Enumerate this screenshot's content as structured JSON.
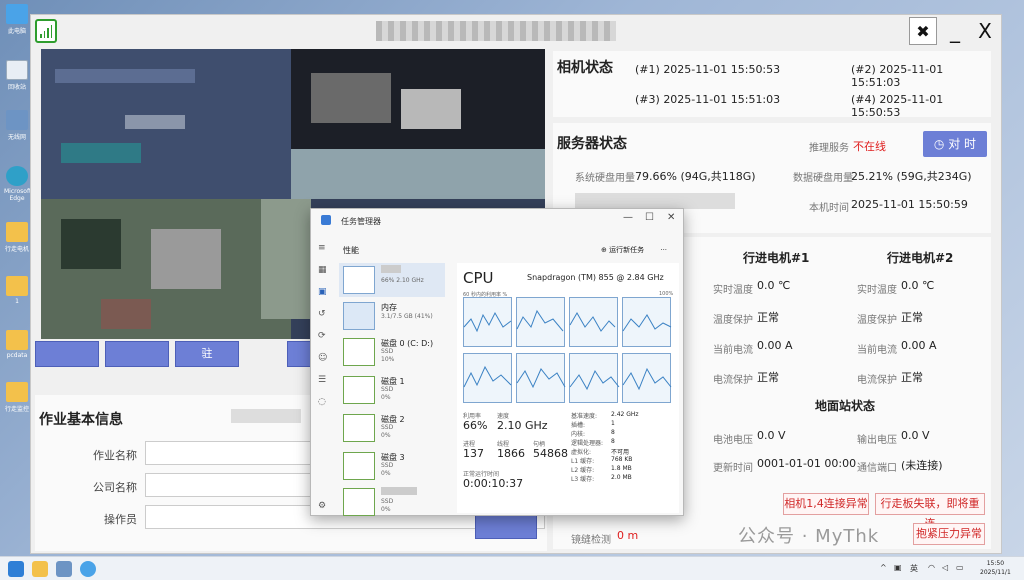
{
  "desktop": {
    "icons": [
      {
        "label": "此电脑"
      },
      {
        "label": "回收站"
      },
      {
        "label": "无线网"
      },
      {
        "label": "Microsoft Edge"
      },
      {
        "label": "行走电机"
      },
      {
        "label": "1"
      },
      {
        "label": "pcdata"
      },
      {
        "label": "行走监控"
      }
    ]
  },
  "app": {
    "title": "■■■■■■■■■■■■■■",
    "tools_icon": "wrench-screwdriver-icon",
    "minimize_label": "_",
    "close_label": "X"
  },
  "camera_buttons": [
    {
      "label": ""
    },
    {
      "label": ""
    },
    {
      "label": "驻"
    },
    {
      "label": ""
    }
  ],
  "job_info": {
    "title": "作业基本信息",
    "fields": [
      {
        "label": "作业名称"
      },
      {
        "label": "公司名称"
      },
      {
        "label": "操作员"
      }
    ]
  },
  "camera_status": {
    "title": "相机状态",
    "items": [
      {
        "id": "(#1)",
        "time": "2025-11-01 15:50:53"
      },
      {
        "id": "(#2)",
        "time": "2025-11-01 15:51:03"
      },
      {
        "id": "(#3)",
        "time": "2025-11-01 15:51:03"
      },
      {
        "id": "(#4)",
        "time": "2025-11-01 15:50:53"
      }
    ]
  },
  "server_status": {
    "title": "服务器状态",
    "push_service_label": "推理服务",
    "push_service_value": "不在线",
    "sync_button": "对 时",
    "sys_disk_label": "系统硬盘用量",
    "sys_disk_value": "79.66% (94G,共118G)",
    "data_disk_label": "数据硬盘用量",
    "data_disk_value": "25.21% (59G,共234G)",
    "local_time_label": "本机时间",
    "local_time_value": "2025-11-01 15:50:59"
  },
  "motors": {
    "motor1_title": "行进电机#1",
    "motor2_title": "行进电机#2",
    "rows": [
      {
        "label": "实时温度",
        "m1": "0.0 ℃",
        "m2": "0.0 ℃"
      },
      {
        "label": "温度保护",
        "m1": "正常",
        "m2": "正常"
      },
      {
        "label": "当前电流",
        "m1": "0.00 A",
        "m2": "0.00 A"
      },
      {
        "label": "电流保护",
        "m1": "正常",
        "m2": "正常"
      }
    ]
  },
  "ground_station": {
    "title": "地面站状态",
    "battery_label": "电池电压",
    "battery_value": "0.0 V",
    "output_label": "输出电压",
    "output_value": "0.0 V",
    "update_label": "更新时间",
    "update_value": "0001-01-01 00:00",
    "port_label": "通信端口",
    "port_value": "(未连接)",
    "distance_label": "镜缝检测",
    "distance_value": "0 m",
    "alarms": [
      "相机1,4连接异常",
      "行走板失联，即将重连",
      "抱紧压力异常"
    ]
  },
  "task_manager": {
    "title": "任务管理器",
    "header": "性能",
    "run_task": "运行新任务",
    "more": "···",
    "list": [
      {
        "name": "",
        "sub": "66% 2.10 GHz"
      },
      {
        "name": "内存",
        "sub": "3.1/7.5 GB (41%)"
      },
      {
        "name": "磁盘 0 (C: D:)",
        "sub": "SSD",
        "sub2": "10%"
      },
      {
        "name": "磁盘 1",
        "sub": "SSD",
        "sub2": "0%"
      },
      {
        "name": "磁盘 2",
        "sub": "SSD",
        "sub2": "0%"
      },
      {
        "name": "磁盘 3",
        "sub": "SSD",
        "sub2": "0%"
      },
      {
        "name": "",
        "sub": "SSD",
        "sub2": "0%"
      }
    ],
    "cpu_label": "CPU",
    "cpu_model": "Snapdragon (TM) 855 @ 2.84 GHz",
    "graph_caption": "60 秒内的利用率 %",
    "graph_max": "100%",
    "util_label": "利用率",
    "util_value": "66%",
    "speed_label": "速度",
    "speed_value": "2.10 GHz",
    "proc_label": "进程",
    "proc_value": "137",
    "thread_label": "线程",
    "thread_value": "1866",
    "handle_label": "句柄",
    "handle_value": "54868",
    "uptime_label": "正常运行时间",
    "uptime_value": "0:00:10:37",
    "details": [
      {
        "label": "基准速度:",
        "value": "2.42 GHz"
      },
      {
        "label": "插槽:",
        "value": "1"
      },
      {
        "label": "内核:",
        "value": "8"
      },
      {
        "label": "逻辑处理器:",
        "value": "8"
      },
      {
        "label": "虚拟化:",
        "value": "不可用"
      },
      {
        "label": "L1 缓存:",
        "value": "768 KB"
      },
      {
        "label": "L2 缓存:",
        "value": "1.8 MB"
      },
      {
        "label": "L3 缓存:",
        "value": "2.0 MB"
      }
    ]
  },
  "watermark": "公众号 · MyThk",
  "taskbar": {
    "lang": "英",
    "time": "15:50",
    "date": "2025/11/1"
  }
}
